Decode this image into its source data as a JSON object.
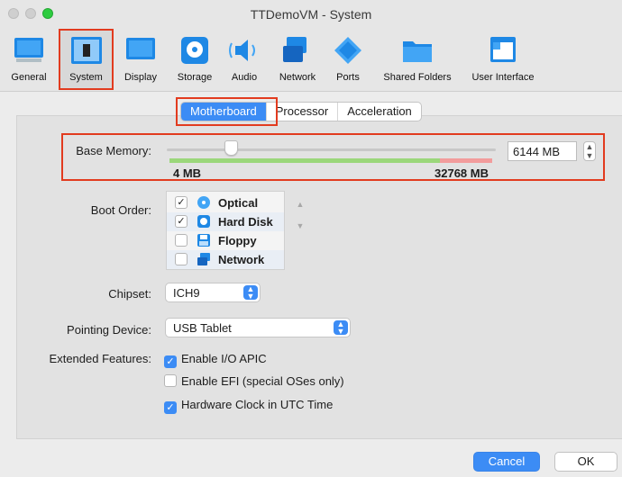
{
  "window": {
    "title": "TTDemoVM - System"
  },
  "toolbar": {
    "items": [
      {
        "label": "General",
        "icon": "monitor-icon"
      },
      {
        "label": "System",
        "icon": "chip-icon"
      },
      {
        "label": "Display",
        "icon": "display-icon"
      },
      {
        "label": "Storage",
        "icon": "disk-icon"
      },
      {
        "label": "Audio",
        "icon": "speaker-icon"
      },
      {
        "label": "Network",
        "icon": "network-icon"
      },
      {
        "label": "Ports",
        "icon": "ports-icon"
      },
      {
        "label": "Shared Folders",
        "icon": "folder-icon"
      },
      {
        "label": "User Interface",
        "icon": "window-icon"
      }
    ],
    "selected": "System"
  },
  "tabs": {
    "items": [
      "Motherboard",
      "Processor",
      "Acceleration"
    ],
    "active": "Motherboard"
  },
  "memory": {
    "label": "Base Memory:",
    "value_text": "6144 MB",
    "min_label": "4 MB",
    "max_label": "32768 MB",
    "value_mb": 6144,
    "min_mb": 4,
    "max_mb": 32768
  },
  "boot": {
    "label": "Boot Order:",
    "items": [
      {
        "label": "Optical",
        "checked": true,
        "icon": "optical-icon"
      },
      {
        "label": "Hard Disk",
        "checked": true,
        "icon": "hard-disk-icon"
      },
      {
        "label": "Floppy",
        "checked": false,
        "icon": "floppy-icon"
      },
      {
        "label": "Network",
        "checked": false,
        "icon": "network-icon"
      }
    ]
  },
  "chipset": {
    "label": "Chipset:",
    "value": "ICH9"
  },
  "pointing": {
    "label": "Pointing Device:",
    "value": "USB Tablet"
  },
  "features": {
    "label": "Extended Features:",
    "items": [
      {
        "label": "Enable I/O APIC",
        "checked": true
      },
      {
        "label": "Enable EFI (special OSes only)",
        "checked": false
      },
      {
        "label": "Hardware Clock in UTC Time",
        "checked": true
      }
    ]
  },
  "buttons": {
    "cancel": "Cancel",
    "ok": "OK"
  },
  "colors": {
    "accent": "#3c8cf5",
    "highlight": "#e23b1f",
    "safe": "#9bd77a",
    "danger": "#f29c9c"
  }
}
